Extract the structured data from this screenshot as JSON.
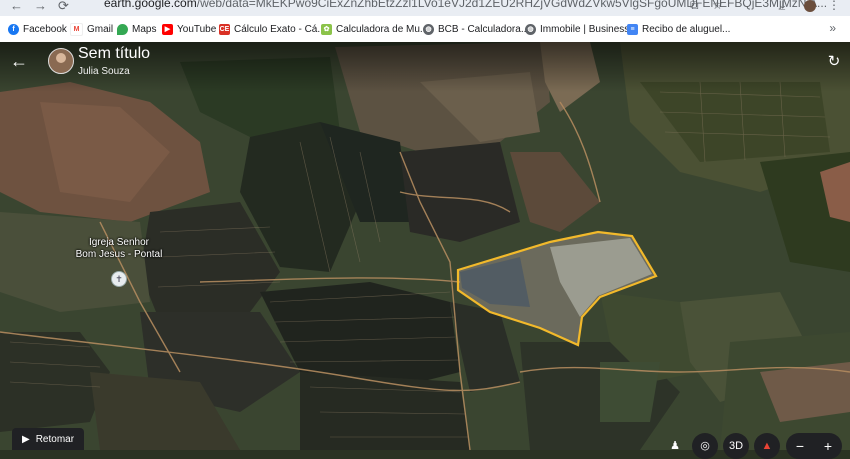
{
  "browser": {
    "url_host": "earth.google.com",
    "url_path": "/web/data=MkEKPwo9CiExZnZhbEtzZzl1LVo1eVJ2d1ZEU2RHZjVGdWdZVkw5VlgSFgoUMDFENEFBQjE3MjMzNjA..."
  },
  "bookmarks": [
    {
      "label": "Facebook",
      "icon": "facebook-icon",
      "color": "#1877f2"
    },
    {
      "label": "Gmail",
      "icon": "gmail-icon",
      "color": "#ea4335"
    },
    {
      "label": "Maps",
      "icon": "maps-icon",
      "color": "#34a853"
    },
    {
      "label": "YouTube",
      "icon": "youtube-icon",
      "color": "#ff0000"
    },
    {
      "label": "Cálculo Exato - Cá...",
      "icon": "calculator-icon",
      "color": "#d93025"
    },
    {
      "label": "Calculadora de Mu...",
      "icon": "leaf-icon",
      "color": "#8bc34a"
    },
    {
      "label": "BCB - Calculadora...",
      "icon": "globe-icon",
      "color": "#5f6368"
    },
    {
      "label": "Immobile | Business",
      "icon": "globe-icon",
      "color": "#5f6368"
    },
    {
      "label": "Recibo de aluguel...",
      "icon": "document-icon",
      "color": "#4285f4"
    }
  ],
  "project": {
    "title": "Sem título",
    "author": "Julia Souza"
  },
  "map": {
    "place_label_line1": "Igreja Senhor",
    "place_label_line2": "Bom Jesus - Pontal",
    "polygon_color": "#f2b92b"
  },
  "controls": {
    "retomar_label": "Retomar",
    "view_3d_label": "3D"
  }
}
